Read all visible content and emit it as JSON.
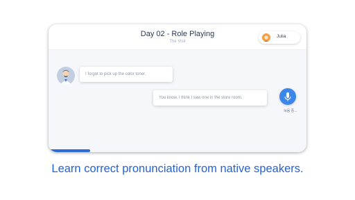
{
  "header": {
    "title": "Day 02 - Role Playing",
    "subtitle": "The Visit",
    "user_name": "Julia"
  },
  "chat": {
    "messages": [
      {
        "from": "bot",
        "text": "I forgot to pick up the color toner."
      },
      {
        "from": "user",
        "text": "You know, I think I saw one in the store room."
      }
    ],
    "mic_caption": "녹음 중..."
  },
  "progress": {
    "fraction": 0.16
  },
  "tagline": "Learn correct pronunciation from native speakers.",
  "icons": {
    "mic": "microphone-icon",
    "bot_avatar": "avatar-icon",
    "user_avatar": "user-avatar-icon"
  },
  "colors": {
    "accent": "#2363d8",
    "mic": "#3b86e8",
    "progress": "#2f6bd8"
  }
}
